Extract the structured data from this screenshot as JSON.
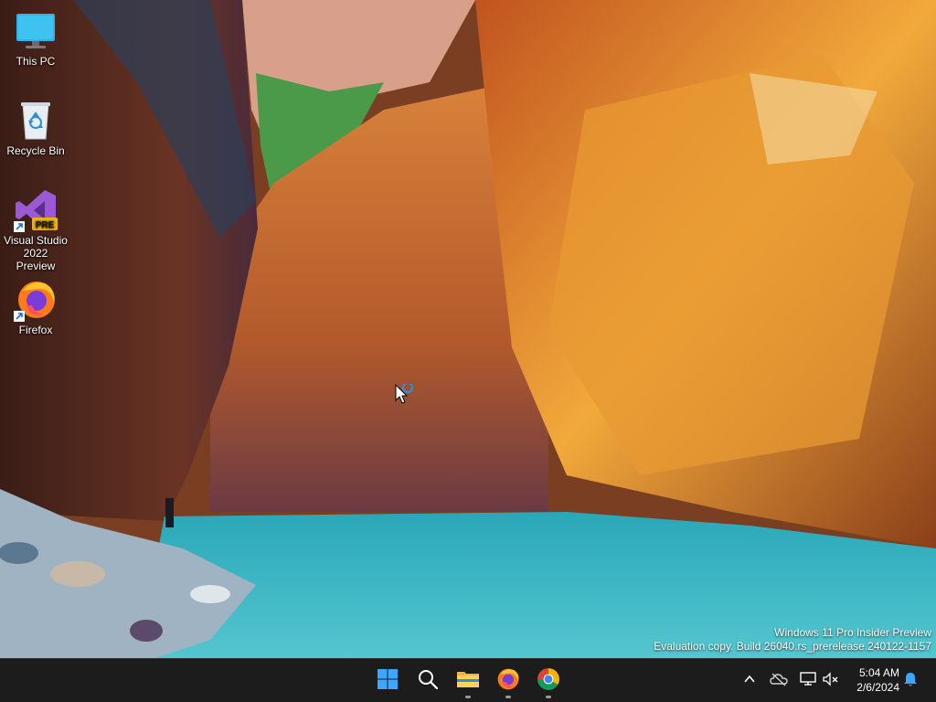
{
  "desktop": {
    "icons": [
      {
        "label": "This PC",
        "icon": "monitor-icon"
      },
      {
        "label": "Recycle Bin",
        "icon": "recycle-bin-icon"
      },
      {
        "label": "Visual Studio 2022 Preview",
        "icon": "visual-studio-icon",
        "badge": "PRE"
      },
      {
        "label": "Firefox",
        "icon": "firefox-icon"
      }
    ],
    "watermark": {
      "line1": "Windows 11 Pro Insider Preview",
      "line2": "Evaluation copy. Build 26040.rs_prerelease.240122-1157"
    }
  },
  "taskbar": {
    "apps": [
      {
        "name": "Start",
        "icon": "windows-start-icon",
        "running": false
      },
      {
        "name": "Search",
        "icon": "search-icon",
        "running": false
      },
      {
        "name": "File Explorer",
        "icon": "folder-icon",
        "running": true
      },
      {
        "name": "Firefox",
        "icon": "firefox-icon",
        "running": true
      },
      {
        "name": "Chrome",
        "icon": "chrome-icon",
        "running": true
      }
    ],
    "tray": {
      "icons": [
        "chevron-up-icon",
        "onedrive-icon",
        "network-icon",
        "volume-muted-icon",
        "notification-bell-icon"
      ]
    },
    "clock": {
      "time": "5:04 AM",
      "date": "2/6/2024"
    }
  },
  "colors": {
    "taskbar_bg": "#1c1c1c",
    "accent_blue": "#0078d4",
    "start_blue": "#3ea6ff"
  }
}
